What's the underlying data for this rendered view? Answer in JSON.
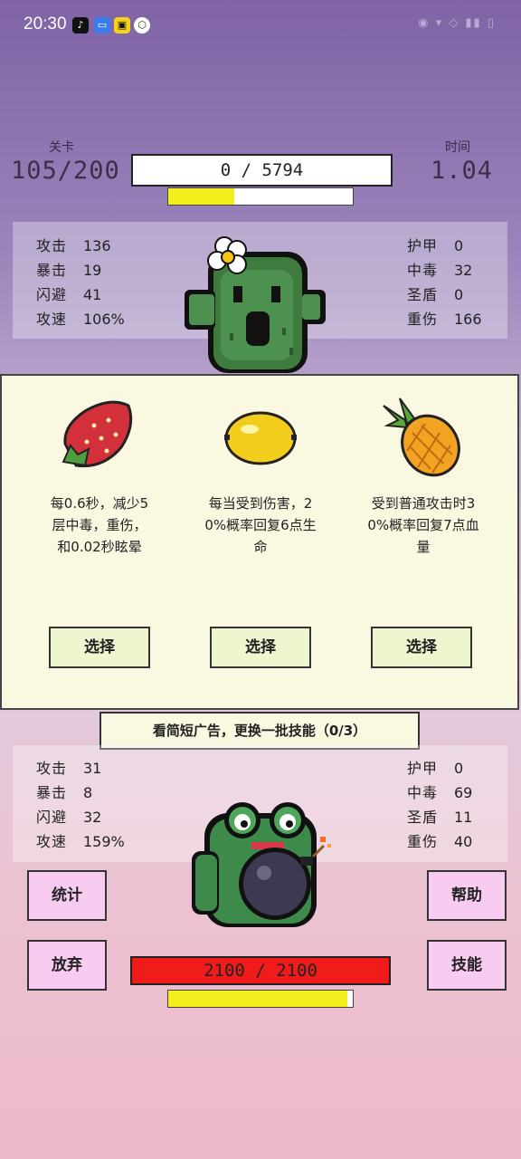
{
  "status_bar": {
    "time": "20:30"
  },
  "level": {
    "label": "关卡",
    "value": "105/200"
  },
  "timer": {
    "label": "时间",
    "value": "1.04"
  },
  "enemy": {
    "hp_text": "0 / 5794",
    "progress": 0.36,
    "stats_left": [
      {
        "k": "攻击",
        "v": "136"
      },
      {
        "k": "暴击",
        "v": "19"
      },
      {
        "k": "闪避",
        "v": "41"
      },
      {
        "k": "攻速",
        "v": "106%"
      }
    ],
    "stats_right": [
      {
        "k": "护甲",
        "v": "0"
      },
      {
        "k": "中毒",
        "v": "32"
      },
      {
        "k": "圣盾",
        "v": "0"
      },
      {
        "k": "重伤",
        "v": "166"
      }
    ]
  },
  "choices": [
    {
      "name": "strawberry-icon",
      "desc_lines": [
        "每0.6秒，减少5",
        "层中毒，重伤，",
        "和0.02秒眩晕"
      ],
      "button": "选择"
    },
    {
      "name": "lemon-icon",
      "desc_lines": [
        "每当受到伤害，2",
        "0%概率回复6点生",
        "命"
      ],
      "button": "选择"
    },
    {
      "name": "pineapple-icon",
      "desc_lines": [
        "受到普通攻击时3",
        "0%概率回复7点血",
        "量"
      ],
      "button": "选择"
    }
  ],
  "ad_refresh": "看简短广告，更换一批技能（0/3）",
  "player": {
    "hp_text": "2100  /  2100",
    "progress": 0.97,
    "stats_left": [
      {
        "k": "攻击",
        "v": "31"
      },
      {
        "k": "暴击",
        "v": "8"
      },
      {
        "k": "闪避",
        "v": "32"
      },
      {
        "k": "攻速",
        "v": "159%"
      }
    ],
    "stats_right": [
      {
        "k": "护甲",
        "v": "0"
      },
      {
        "k": "中毒",
        "v": "69"
      },
      {
        "k": "圣盾",
        "v": "11"
      },
      {
        "k": "重伤",
        "v": "40"
      }
    ]
  },
  "buttons": {
    "stats": "统计",
    "help": "帮助",
    "quit": "放弃",
    "skills": "技能"
  }
}
